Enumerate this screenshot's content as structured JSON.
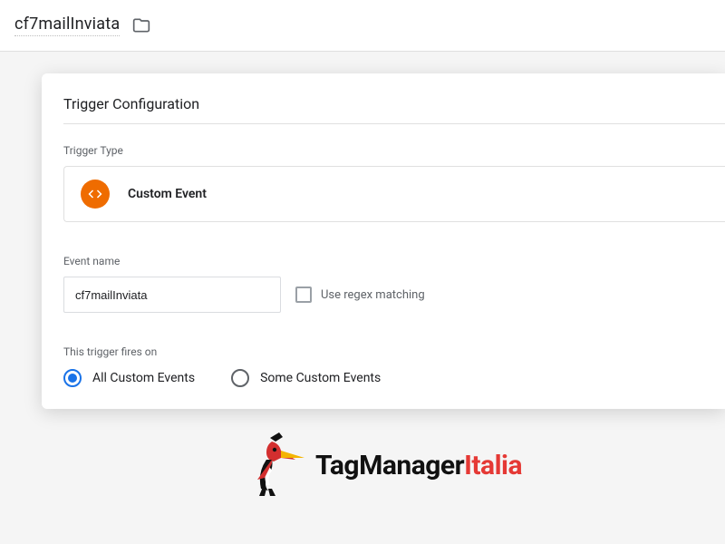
{
  "header": {
    "title": "cf7mailInviata"
  },
  "card": {
    "title": "Trigger Configuration",
    "triggerTypeLabel": "Trigger Type",
    "triggerTypeValue": "Custom Event",
    "eventNameLabel": "Event name",
    "eventNameValue": "cf7mailInviata",
    "regexLabel": "Use regex matching",
    "firesOnLabel": "This trigger fires on",
    "radioAll": "All Custom Events",
    "radioSome": "Some Custom Events"
  },
  "brand": {
    "part1": "TagManager",
    "part2": "Italia"
  }
}
